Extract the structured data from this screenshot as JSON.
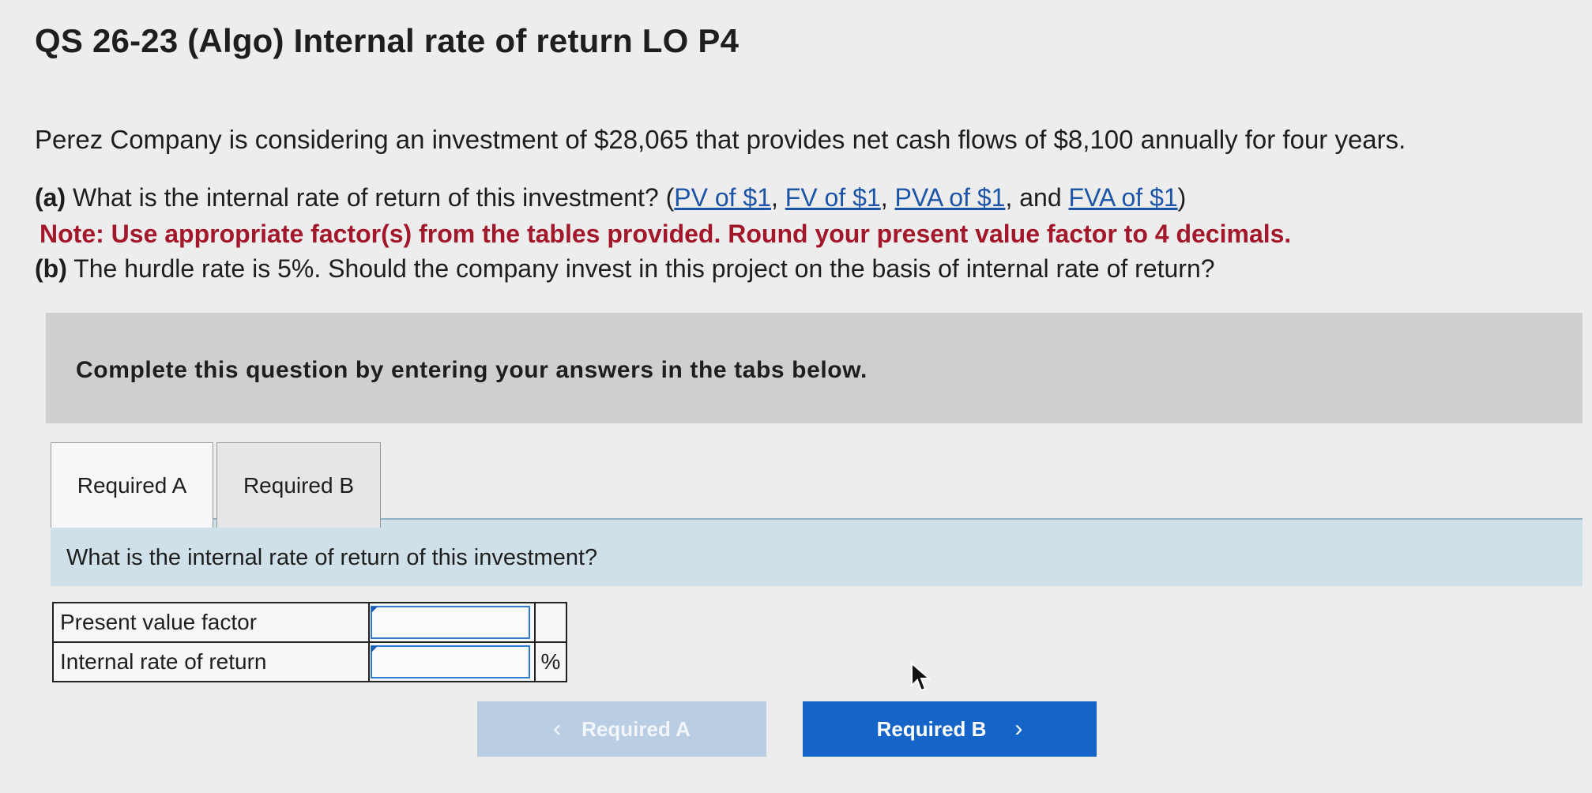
{
  "title": "QS 26-23 (Algo) Internal rate of return LO P4",
  "intro": "Perez Company is considering an investment of $28,065 that provides net cash flows of $8,100 annually for four years.",
  "part_a": {
    "label": "(a)",
    "text": "What is the internal rate of return of this investment?",
    "refs": [
      "PV of $1",
      "FV of $1",
      "PVA of $1",
      "FVA of $1"
    ],
    "open_paren": "(",
    "sep1": ", ",
    "sep2": ", ",
    "and": ", and ",
    "close_paren": ")"
  },
  "note": "Note: Use appropriate factor(s) from the tables provided. Round your present value factor to 4 decimals.",
  "part_b": {
    "label": "(b)",
    "text": "The hurdle rate is 5%. Should the company invest in this project on the basis of internal rate of return?"
  },
  "instructions": "Complete this question by entering your answers in the tabs below.",
  "tabs": [
    {
      "label": "Required A",
      "active": true
    },
    {
      "label": "Required B",
      "active": false
    }
  ],
  "question": "What is the internal rate of return of this investment?",
  "table": {
    "rows": [
      {
        "label": "Present value factor",
        "value": "",
        "unit": ""
      },
      {
        "label": "Internal rate of return",
        "value": "",
        "unit": "%"
      }
    ]
  },
  "nav": {
    "prev_label": "Required A",
    "next_label": "Required B",
    "prev_icon": "chevron-left-icon",
    "next_icon": "chevron-right-icon"
  },
  "colors": {
    "note": "#a3172a",
    "link": "#1c55a8",
    "primary": "#1565c8",
    "disabled": "#b9cde3"
  }
}
